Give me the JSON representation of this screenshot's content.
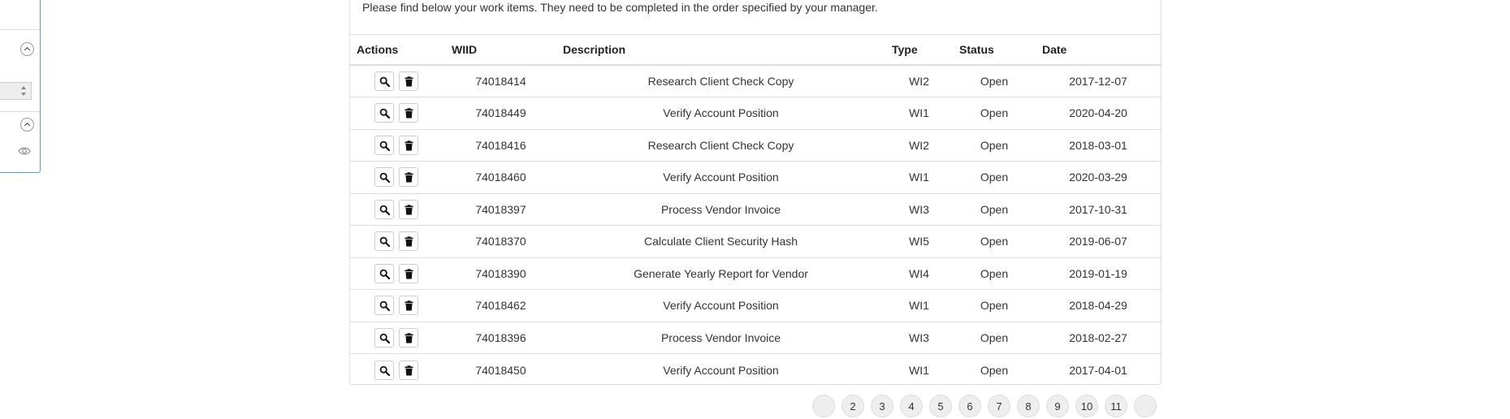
{
  "intro_text": "Please find below your work items. They need to be completed in the order specified by your manager.",
  "table": {
    "headers": {
      "actions": "Actions",
      "wiid": "WIID",
      "description": "Description",
      "type": "Type",
      "status": "Status",
      "date": "Date"
    },
    "rows": [
      {
        "wiid": "74018414",
        "description": "Research Client Check Copy",
        "type": "WI2",
        "status": "Open",
        "date": "2017-12-07"
      },
      {
        "wiid": "74018449",
        "description": "Verify Account Position",
        "type": "WI1",
        "status": "Open",
        "date": "2020-04-20"
      },
      {
        "wiid": "74018416",
        "description": "Research Client Check Copy",
        "type": "WI2",
        "status": "Open",
        "date": "2018-03-01"
      },
      {
        "wiid": "74018460",
        "description": "Verify Account Position",
        "type": "WI1",
        "status": "Open",
        "date": "2020-03-29"
      },
      {
        "wiid": "74018397",
        "description": "Process Vendor Invoice",
        "type": "WI3",
        "status": "Open",
        "date": "2017-10-31"
      },
      {
        "wiid": "74018370",
        "description": "Calculate Client Security Hash",
        "type": "WI5",
        "status": "Open",
        "date": "2019-06-07"
      },
      {
        "wiid": "74018390",
        "description": "Generate Yearly Report for Vendor",
        "type": "WI4",
        "status": "Open",
        "date": "2019-01-19"
      },
      {
        "wiid": "74018462",
        "description": "Verify Account Position",
        "type": "WI1",
        "status": "Open",
        "date": "2018-04-29"
      },
      {
        "wiid": "74018396",
        "description": "Process Vendor Invoice",
        "type": "WI3",
        "status": "Open",
        "date": "2018-02-27"
      },
      {
        "wiid": "74018450",
        "description": "Verify Account Position",
        "type": "WI1",
        "status": "Open",
        "date": "2017-04-01"
      }
    ],
    "action_icons": [
      "search-icon",
      "trash-icon"
    ]
  },
  "pagination": {
    "pages": [
      "",
      "2",
      "3",
      "4",
      "5",
      "6",
      "7",
      "8",
      "9",
      "10",
      "11",
      ""
    ]
  },
  "colors": {
    "panel_border": "#5b9bd5",
    "border": "#dddddd",
    "text": "#333333"
  }
}
